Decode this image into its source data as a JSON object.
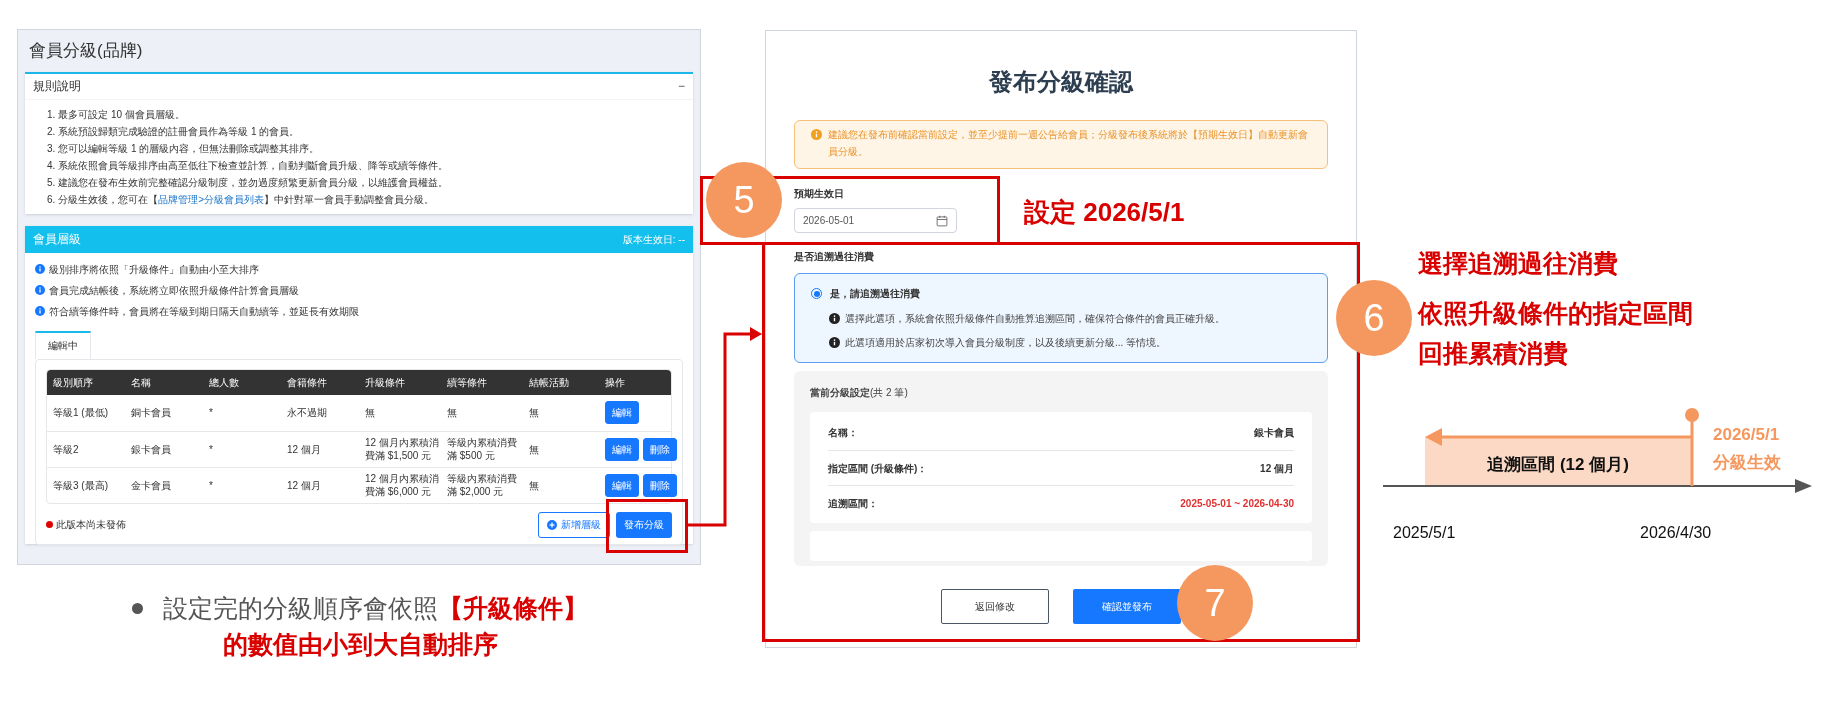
{
  "left_screen": {
    "title": "會員分級(品牌)",
    "rules_panel": {
      "title": "規則說明",
      "toggle": "−",
      "items": [
        {
          "text": "1. 最多可設定 10 個會員層級。"
        },
        {
          "text": "2. 系統預設歸類完成驗證的註冊會員作為等級 1 的會員。"
        },
        {
          "text": "3. 您可以編輯等級 1 的層級內容，但無法刪除或調整其排序。"
        },
        {
          "text": "4. 系統依照會員等級排序由高至低往下檢查並計算，自動判斷會員升級、降等或續等條件。"
        },
        {
          "text": "5. 建議您在發布生效前完整確認分級制度，並勿過度頻繁更新會員分級，以維護會員權益。"
        },
        {
          "text": "6. 分級生效後，您可在【",
          "link": "品牌管理>分級會員列表",
          "after": "】中針對單一會員手動調整會員分級。"
        }
      ]
    },
    "tiers_panel": {
      "title": "會員層級",
      "effective_date": "版本生效日: --",
      "notes": [
        "級別排序將依照「升級條件」自動由小至大排序",
        "會員完成結帳後，系統將立即依照升級條件計算會員層級",
        "符合續等條件時，會員將在等級到期日隔天自動續等，並延長有效期限"
      ],
      "tabs": [
        {
          "label": "編輯中",
          "selected": true
        }
      ],
      "table": {
        "columns": [
          "級別順序",
          "名稱",
          "總人數",
          "會籍條件",
          "升級條件",
          "續等條件",
          "結帳活動",
          "操作"
        ],
        "rows": [
          {
            "cells": [
              "等級1 (最低)",
              "銅卡會員",
              "*",
              "永不過期",
              "無",
              "無",
              "無"
            ],
            "actions": [
              "編輯"
            ]
          },
          {
            "cells": [
              "等級2",
              "銀卡會員",
              "*",
              "12 個月",
              "12 個月內累積消費滿 $1,500 元",
              "等級內累積消費滿 $500 元",
              "無"
            ],
            "actions": [
              "編輯",
              "刪除"
            ]
          },
          {
            "cells": [
              "等級3 (最高)",
              "金卡會員",
              "*",
              "12 個月",
              "12 個月內累積消費滿 $6,000 元",
              "等級內累積消費滿 $2,000 元",
              "無"
            ],
            "actions": [
              "編輯",
              "刪除"
            ]
          }
        ]
      },
      "status": {
        "text": "此版本尚未發佈",
        "color": "#e00000"
      },
      "buttons": [
        {
          "label": "新增層級",
          "kind": "outline"
        },
        {
          "label": "發布分級",
          "kind": "primary"
        }
      ]
    }
  },
  "caption": {
    "lines": [
      {
        "text": "設定完的分級順序會依照**【升級條件】**",
        "kind": "mixed"
      },
      {
        "text": "的數值由小到大自動排序",
        "kind": "emphasis"
      }
    ]
  },
  "dialog": {
    "title": "發布分級確認",
    "warning": "建議您在發布前確認當前設定，並至少提前一週公告給會員；分級發布後系統將於【預期生效日】自動更新會員分級。",
    "date_field": {
      "label": "預期生效日",
      "value": "2026-05-01"
    },
    "retro_section": {
      "label": "是否追溯過往消費",
      "options": [
        {
          "label": "是，請追溯過往消費",
          "selected": true,
          "notes": [
            "選擇此選項，系統會依照升級條件自動推算追溯區間，確保符合條件的會員正確升級。",
            "此選項適用於店家初次導入會員分級制度，以及後續更新分級... 等情境。"
          ]
        }
      ]
    },
    "summary": {
      "title": "**當前分級設定**(共 2 筆)",
      "records": [
        {
          "fields": [
            {
              "label": "名稱：",
              "value": "銀卡會員",
              "highlight": false
            },
            {
              "label": "指定區間 (升級條件)：",
              "value": "12 個月",
              "highlight": false
            },
            {
              "label": "追溯區間：",
              "value": "2025-05-01 ~ 2026-04-30",
              "highlight": true
            }
          ]
        }
      ]
    },
    "buttons": [
      {
        "label": "返回修改",
        "kind": "outline"
      },
      {
        "label": "確認並發布",
        "kind": "primary"
      }
    ]
  },
  "annotations": {
    "steps": [
      "5",
      "6",
      "7"
    ],
    "date_note": "設定 2026/5/1",
    "retro_notes": [
      "選擇追溯過往消費",
      "依照升級條件的指定區間",
      "回推累積消費"
    ]
  },
  "timeline": {
    "period_label": "追溯區間 (12 個月)",
    "effective_date": "2026/5/1",
    "effective_label": "分級生效",
    "start_date": "2025/5/1",
    "end_date": "2026/4/30"
  }
}
